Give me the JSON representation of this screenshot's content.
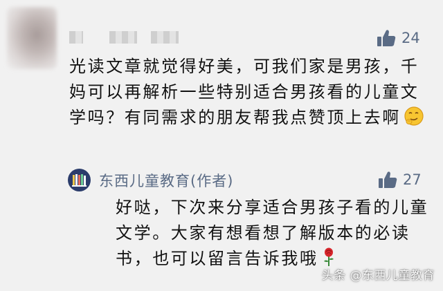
{
  "top_comment": {
    "likes": "24",
    "text": "光读文章就觉得好美，可我们家是男孩，千妈可以再解析一些特别适合男孩看的儿童文学吗？有同需求的朋友帮我点赞顶上去啊"
  },
  "reply": {
    "author": "东西儿童教育(作者)",
    "likes": "27",
    "text": "好哒，下次来分享适合男孩子看的儿童文学。大家有想看想了解版本的必读书，也可以留言告诉我哦"
  },
  "watermark": "头条 @东西儿童教育",
  "colors": {
    "background": "#f1f1f1",
    "accent": "#5a6b85",
    "text": "#111111"
  }
}
